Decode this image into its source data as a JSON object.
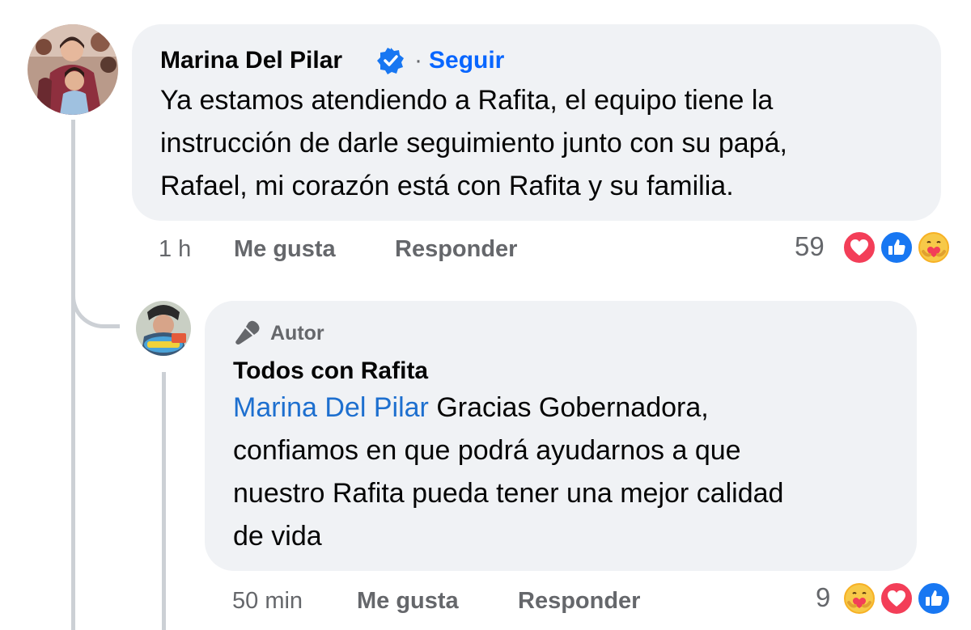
{
  "comment": {
    "author_name": "Marina Del Pilar",
    "verified_icon": "verified-badge-icon",
    "follow_label": "Seguir",
    "text_lines": [
      "Ya estamos atendiendo a Rafita, el equipo tiene la",
      "instrucción de darle seguimiento junto con su papá,",
      "Rafael, mi corazón está con Rafita y su familia."
    ],
    "time": "1 h",
    "like_label": "Me gusta",
    "reply_label": "Responder",
    "reaction_count": "59",
    "reactions": [
      "love-reaction-icon",
      "like-reaction-icon",
      "care-reaction-icon"
    ]
  },
  "reply": {
    "badge_label": "Autor",
    "badge_icon": "microphone-icon",
    "author_name": "Todos con Rafita",
    "mention": "Marina Del Pilar",
    "text_first": "Gracias Gobernadora,",
    "text_lines": [
      "confiamos en que podrá ayudarnos a que",
      "nuestro Rafita pueda tener una mejor calidad",
      "de vida"
    ],
    "time": "50 min",
    "like_label": "Me gusta",
    "reply_label": "Responder",
    "reaction_count": "9",
    "reactions": [
      "care-reaction-icon",
      "love-reaction-icon",
      "like-reaction-icon"
    ]
  },
  "colors": {
    "bubble": "#f0f2f5",
    "link_blue": "#0866ff",
    "mention_blue": "#1d6fcf",
    "meta_gray": "#65676b",
    "love_red": "#f33e58",
    "like_blue": "#1877f2",
    "care_yellow": "#f7b125"
  }
}
